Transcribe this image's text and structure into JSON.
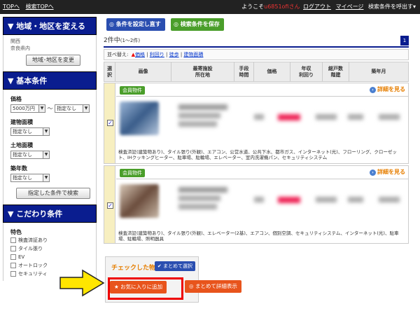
{
  "topbar": {
    "top_link": "TOPへ",
    "search_top_link": "検索TOPへ",
    "welcome": "ようこそ",
    "user_name": "u6851ofiさん",
    "logout": "ログアウト",
    "mypage": "マイページ",
    "saved_search": "検索条件を呼出す▾"
  },
  "sidebar": {
    "region_header": "▼ 地域・地区を変える",
    "region_line1": "関西",
    "region_line2": "奈良県内",
    "region_button": "地域･地区を変更",
    "basic_header": "▼ 基本条件",
    "price_label": "価格",
    "price_min": "5000万円",
    "price_sep": "〜",
    "price_max": "指定なし",
    "building_label": "建物面積",
    "building_value": "指定なし",
    "land_label": "土地面積",
    "land_value": "指定なし",
    "age_label": "築年数",
    "age_value": "指定なし",
    "search_button": "指定した条件で検索",
    "kodawari_header": "▼ こだわり条件",
    "features_label": "特色",
    "features": [
      "検査済証あり",
      "タイル張り",
      "EV",
      "オートロック",
      "セキュリティ"
    ]
  },
  "toolbar": {
    "reset_button": "条件を設定し直す",
    "save_button": "検索条件を保存"
  },
  "results": {
    "count": "2件中",
    "range": "(1〜2件)",
    "page": "1"
  },
  "sort": {
    "label": "並べ替え:",
    "options": [
      "価格",
      "利回り",
      "徒歩",
      "建物面積"
    ]
  },
  "table_headers": {
    "select": "選\n択",
    "image": "画像",
    "station": "最寄施設\n所在地",
    "walk": "手段\n時間",
    "price": "価格",
    "yield": "年収\n利回り",
    "units": "総戸数\n階建",
    "built": "築年月"
  },
  "properties": [
    {
      "badge": "会員物件",
      "detail": "詳細を見る",
      "features": "検査済証(建築物あり)、タイル張り(外観)、エアコン、公営水道、公共下水、都市ガス、インターネット(光)、フローリング、クローゼット、IHクッキングヒーター、駐車場、駐輪場、エレベーター、室内洗濯機パン、セキュリティシステム"
    },
    {
      "badge": "会員物件",
      "detail": "詳細を見る",
      "features": "検査済証(建築物あり)、タイル張り(外観)、エレベーター(2基)、エアコン、個別空調、セキュリティシステム、インターネット(光)、駐車場、駐輪場、照明器具"
    }
  ],
  "bottom": {
    "checked_label": "チェックした物件を",
    "select_all": "まとめて選択",
    "add_favorite": "お気に入りに追加",
    "bulk_detail": "まとめて詳細表示"
  },
  "colors": {
    "navy": "#0a1d8f",
    "orange": "#e8541c",
    "green": "#4a9e2a",
    "blue_button": "#2a4eb0"
  }
}
